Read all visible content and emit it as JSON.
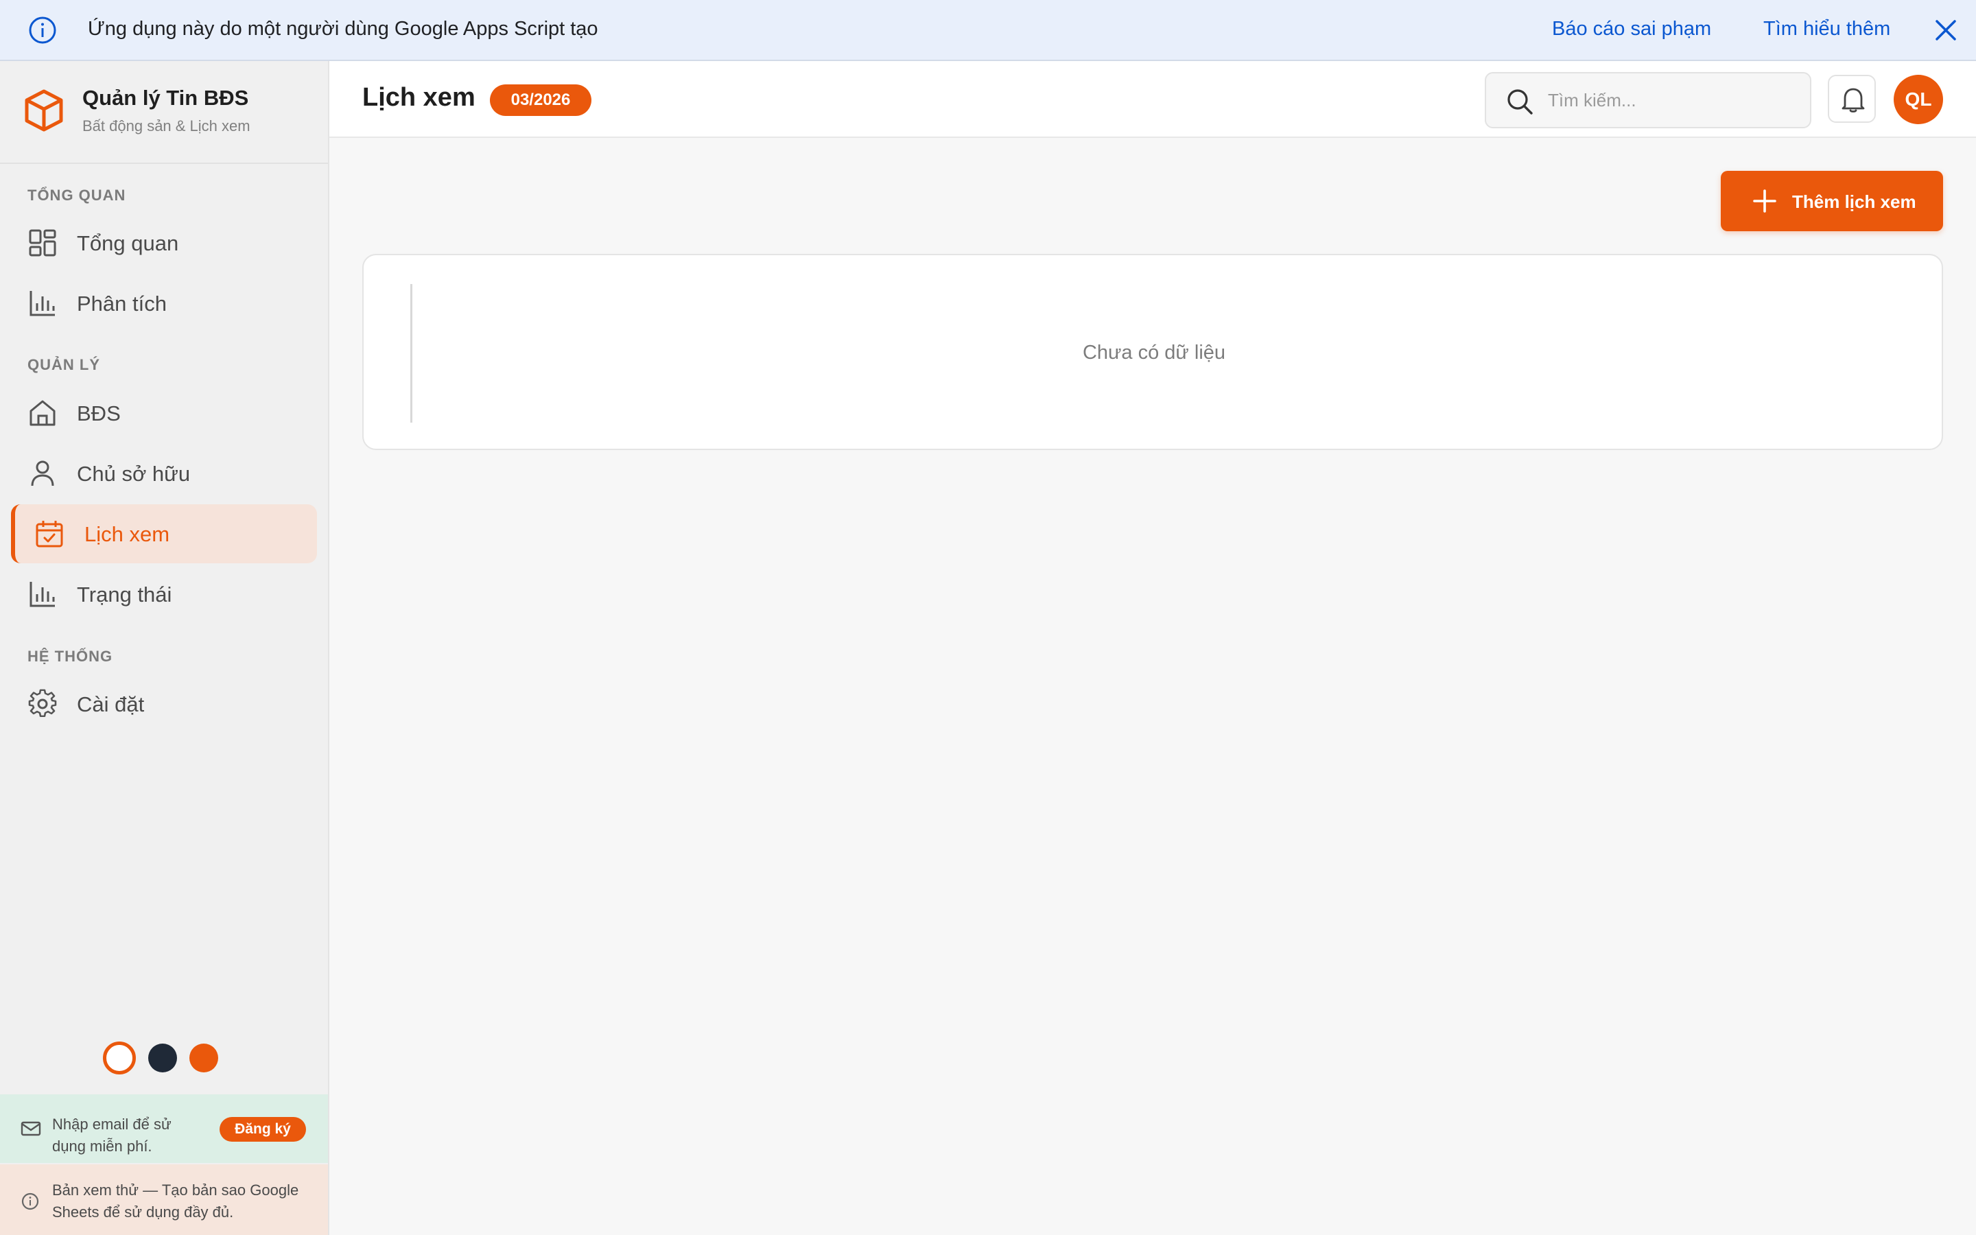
{
  "banner": {
    "message": "Ứng dụng này do một người dùng Google Apps Script tạo",
    "report_link": "Báo cáo sai phạm",
    "learn_link": "Tìm hiểu thêm"
  },
  "brand": {
    "name": "Quản lý Tin BĐS",
    "subtitle": "Bất động sản & Lịch xem"
  },
  "sidebar": {
    "sections": [
      {
        "label": "TỔNG QUAN"
      },
      {
        "label": "QUẢN LÝ"
      },
      {
        "label": "HỆ THỐNG"
      }
    ],
    "items": [
      {
        "label": "Tổng quan",
        "icon": "grid-icon"
      },
      {
        "label": "Phân tích",
        "icon": "bar-chart-icon"
      },
      {
        "label": "BĐS",
        "icon": "home-icon"
      },
      {
        "label": "Chủ sở hữu",
        "icon": "user-icon"
      },
      {
        "label": "Lịch xem",
        "icon": "calendar-check-icon",
        "active": true
      },
      {
        "label": "Trạng thái",
        "icon": "bar-chart-icon"
      },
      {
        "label": "Cài đặt",
        "icon": "gear-icon"
      }
    ],
    "theme_colors": [
      "#ffffff",
      "#1f2937",
      "#ea580c"
    ],
    "email_prompt": {
      "text": "Nhập email để sử dụng miễn phí.",
      "button": "Đăng ký"
    },
    "trial_notice": "Bản xem thử — Tạo bản sao Google Sheets để sử dụng đầy đủ."
  },
  "header": {
    "title": "Lịch xem",
    "period_badge": "03/2026",
    "search_placeholder": "Tìm kiếm...",
    "avatar_initials": "QL"
  },
  "main": {
    "add_button": "Thêm lịch xem",
    "empty_text": "Chưa có dữ liệu"
  },
  "colors": {
    "accent": "#ea580c",
    "banner_link": "#0b57d0",
    "banner_bg": "#e8effb"
  }
}
